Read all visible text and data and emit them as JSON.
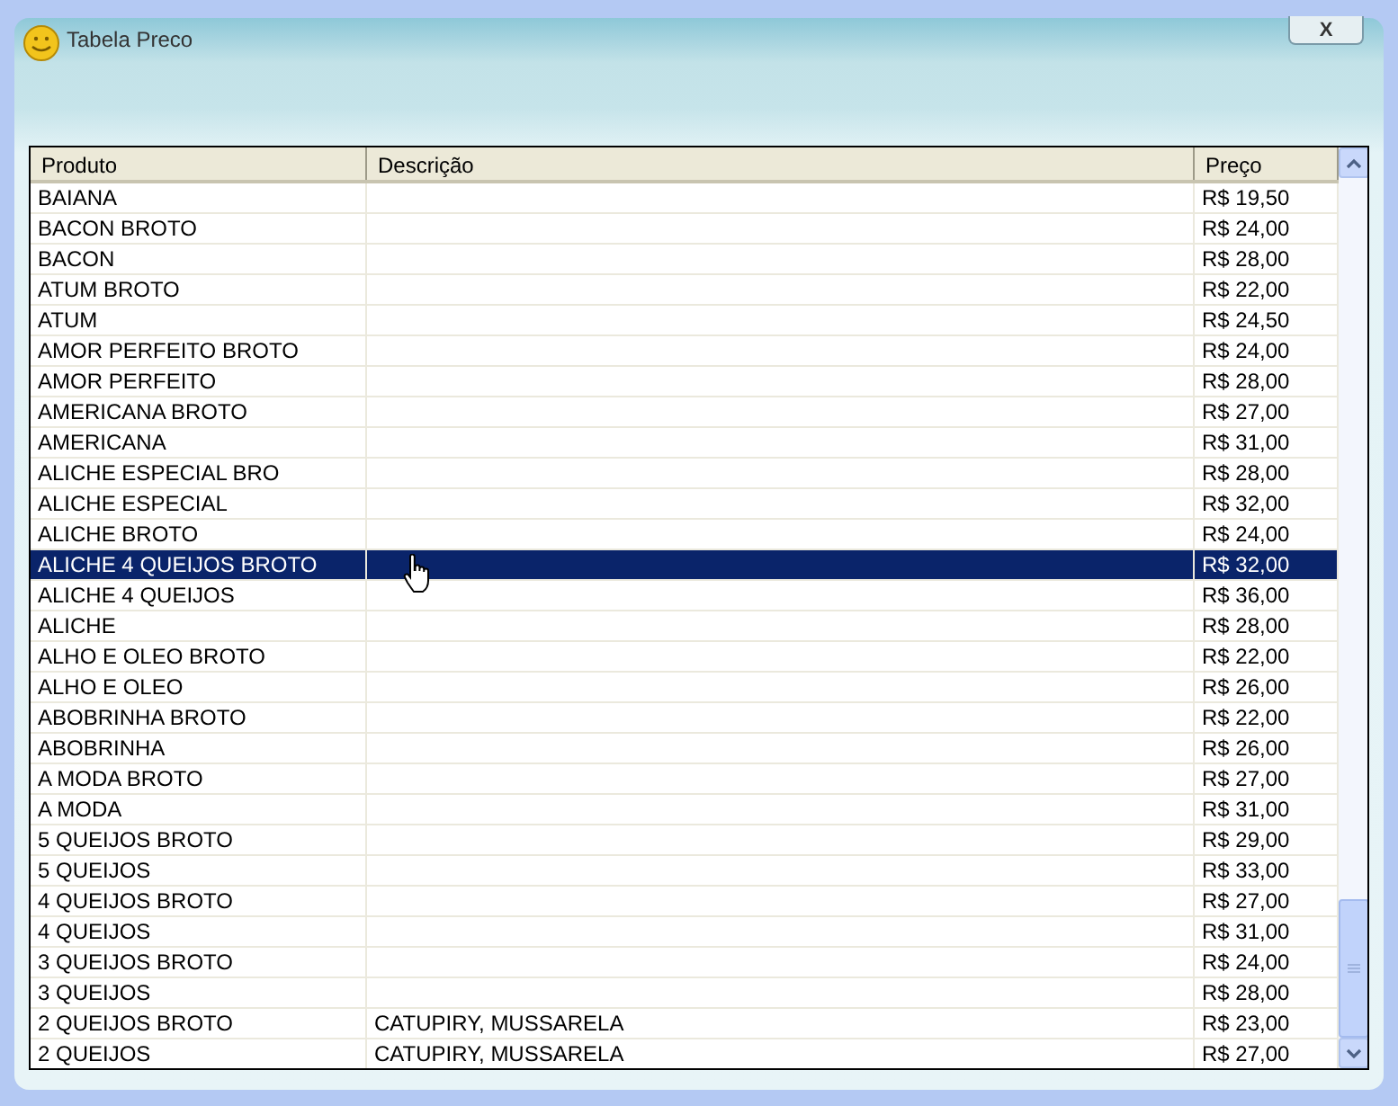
{
  "window": {
    "title": "Tabela Preco",
    "close_label": "X"
  },
  "table": {
    "columns": [
      "Produto",
      "Descrição",
      "Preço"
    ],
    "rows": [
      {
        "produto": "BAIANA",
        "descricao": "",
        "preco": "R$ 19,50",
        "selected": false
      },
      {
        "produto": "BACON BROTO",
        "descricao": "",
        "preco": "R$ 24,00",
        "selected": false
      },
      {
        "produto": "BACON",
        "descricao": "",
        "preco": "R$ 28,00",
        "selected": false
      },
      {
        "produto": "ATUM BROTO",
        "descricao": "",
        "preco": "R$ 22,00",
        "selected": false
      },
      {
        "produto": "ATUM",
        "descricao": "",
        "preco": "R$ 24,50",
        "selected": false
      },
      {
        "produto": "AMOR PERFEITO BROTO",
        "descricao": "",
        "preco": "R$ 24,00",
        "selected": false
      },
      {
        "produto": "AMOR PERFEITO",
        "descricao": "",
        "preco": "R$ 28,00",
        "selected": false
      },
      {
        "produto": "AMERICANA BROTO",
        "descricao": "",
        "preco": "R$ 27,00",
        "selected": false
      },
      {
        "produto": "AMERICANA",
        "descricao": "",
        "preco": "R$ 31,00",
        "selected": false
      },
      {
        "produto": "ALICHE ESPECIAL BRO",
        "descricao": "",
        "preco": "R$ 28,00",
        "selected": false
      },
      {
        "produto": "ALICHE ESPECIAL",
        "descricao": "",
        "preco": "R$ 32,00",
        "selected": false
      },
      {
        "produto": "ALICHE BROTO",
        "descricao": "",
        "preco": "R$ 24,00",
        "selected": false
      },
      {
        "produto": "ALICHE 4 QUEIJOS BROTO",
        "descricao": "",
        "preco": "R$ 32,00",
        "selected": true
      },
      {
        "produto": "ALICHE 4 QUEIJOS",
        "descricao": "",
        "preco": "R$ 36,00",
        "selected": false
      },
      {
        "produto": "ALICHE",
        "descricao": "",
        "preco": "R$ 28,00",
        "selected": false
      },
      {
        "produto": "ALHO E OLEO BROTO",
        "descricao": "",
        "preco": "R$ 22,00",
        "selected": false
      },
      {
        "produto": "ALHO E OLEO",
        "descricao": "",
        "preco": "R$ 26,00",
        "selected": false
      },
      {
        "produto": "ABOBRINHA BROTO",
        "descricao": "",
        "preco": "R$ 22,00",
        "selected": false
      },
      {
        "produto": "ABOBRINHA",
        "descricao": "",
        "preco": "R$ 26,00",
        "selected": false
      },
      {
        "produto": "A MODA BROTO",
        "descricao": "",
        "preco": "R$ 27,00",
        "selected": false
      },
      {
        "produto": "A MODA",
        "descricao": "",
        "preco": "R$ 31,00",
        "selected": false
      },
      {
        "produto": "5 QUEIJOS BROTO",
        "descricao": "",
        "preco": "R$ 29,00",
        "selected": false
      },
      {
        "produto": "5 QUEIJOS",
        "descricao": "",
        "preco": "R$ 33,00",
        "selected": false
      },
      {
        "produto": "4 QUEIJOS BROTO",
        "descricao": "",
        "preco": "R$ 27,00",
        "selected": false
      },
      {
        "produto": "4 QUEIJOS",
        "descricao": "",
        "preco": "R$ 31,00",
        "selected": false
      },
      {
        "produto": "3 QUEIJOS BROTO",
        "descricao": "",
        "preco": "R$ 24,00",
        "selected": false
      },
      {
        "produto": "3 QUEIJOS",
        "descricao": "",
        "preco": "R$ 28,00",
        "selected": false
      },
      {
        "produto": "2 QUEIJOS BROTO",
        "descricao": "CATUPIRY, MUSSARELA",
        "preco": "R$ 23,00",
        "selected": false
      },
      {
        "produto": "2 QUEIJOS",
        "descricao": "CATUPIRY, MUSSARELA",
        "preco": "R$ 27,00",
        "selected": false
      }
    ]
  }
}
